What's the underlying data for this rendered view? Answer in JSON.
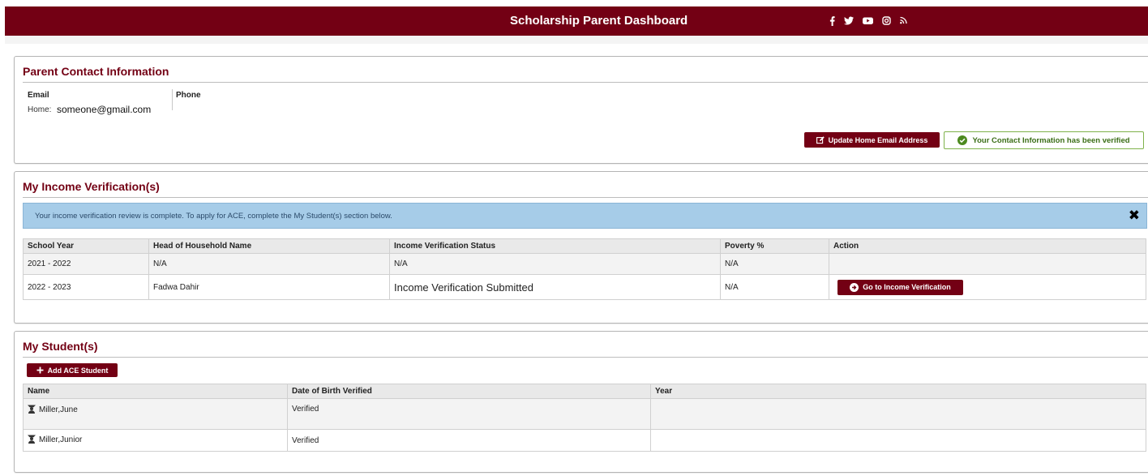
{
  "header": {
    "title": "Scholarship Parent Dashboard",
    "social_icons": [
      "facebook-icon",
      "twitter-icon",
      "youtube-icon",
      "instagram-icon",
      "rss-icon"
    ]
  },
  "contact": {
    "title": "Parent Contact Information",
    "email_label": "Email",
    "phone_label": "Phone",
    "home_label": "Home:",
    "email_value": "someone@gmail.com",
    "update_button": "Update Home Email Address",
    "verified_text": "Your Contact Information has been verified"
  },
  "income": {
    "title": "My Income Verification(s)",
    "alert": "Your income verification review is complete. To apply for ACE, complete the My Student(s) section below.",
    "close": "✖",
    "columns": [
      "School Year",
      "Head of Household Name",
      "Income Verification Status",
      "Poverty %",
      "Action"
    ],
    "rows": [
      {
        "year": "2021 - 2022",
        "name": "N/A",
        "status": "N/A",
        "poverty": "N/A"
      },
      {
        "year": "2022 - 2023",
        "name": "Fadwa Dahir",
        "status": "Income Verification Submitted",
        "poverty": "N/A",
        "action": "Go to Income Verification"
      }
    ]
  },
  "students": {
    "title": "My Student(s)",
    "add_button": "Add ACE Student",
    "columns": [
      "Name",
      "Date of Birth Verified",
      "Year"
    ],
    "rows": [
      {
        "name": "Miller,June",
        "dob": "Verified",
        "year": ""
      },
      {
        "name": "Miller,Junior",
        "dob": "Verified",
        "year": ""
      }
    ]
  },
  "colors": {
    "brand": "#730014",
    "alert_bg": "#a6cce8",
    "verified_border": "#7fb24b",
    "verified_icon": "#4c8a1e"
  }
}
